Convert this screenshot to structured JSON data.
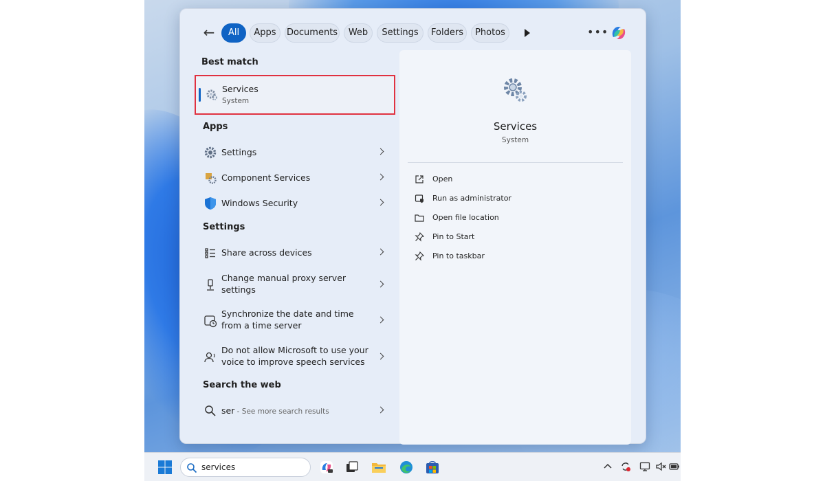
{
  "filters": {
    "tabs": [
      {
        "label": "All",
        "active": true
      },
      {
        "label": "Apps"
      },
      {
        "label": "Documents"
      },
      {
        "label": "Web"
      },
      {
        "label": "Settings"
      },
      {
        "label": "Folders"
      },
      {
        "label": "Photos"
      }
    ]
  },
  "best_match": {
    "heading": "Best match",
    "item": {
      "title": "Services",
      "subtitle": "System",
      "icon": "services-gear-icon"
    }
  },
  "apps": {
    "heading": "Apps",
    "items": [
      {
        "label": "Settings",
        "icon": "settings-gear-icon"
      },
      {
        "label": "Component Services",
        "icon": "component-services-icon"
      },
      {
        "label": "Windows Security",
        "icon": "shield-icon"
      }
    ]
  },
  "settings": {
    "heading": "Settings",
    "items": [
      {
        "line1": "Share across devices",
        "icon": "share-devices-icon"
      },
      {
        "line1": "Change manual proxy server",
        "line2": "settings",
        "icon": "proxy-icon"
      },
      {
        "line1": "Synchronize the date and time",
        "line2": "from a time server",
        "icon": "clock-sync-icon"
      },
      {
        "line1": "Do not allow Microsoft to use your",
        "line2": "voice to improve speech services",
        "icon": "voice-icon"
      }
    ]
  },
  "web": {
    "heading": "Search the web",
    "query": "ser",
    "hint": " - See more search results"
  },
  "preview": {
    "title": "Services",
    "subtitle": "System",
    "actions": [
      {
        "label": "Open",
        "icon": "open-external-icon"
      },
      {
        "label": "Run as administrator",
        "icon": "admin-shield-icon"
      },
      {
        "label": "Open file location",
        "icon": "folder-icon"
      },
      {
        "label": "Pin to Start",
        "icon": "pin-icon"
      },
      {
        "label": "Pin to taskbar",
        "icon": "pin-icon"
      }
    ]
  },
  "taskbar": {
    "search_value": "services"
  },
  "colors": {
    "accent": "#0f63c4",
    "highlight_border": "#e03140"
  }
}
